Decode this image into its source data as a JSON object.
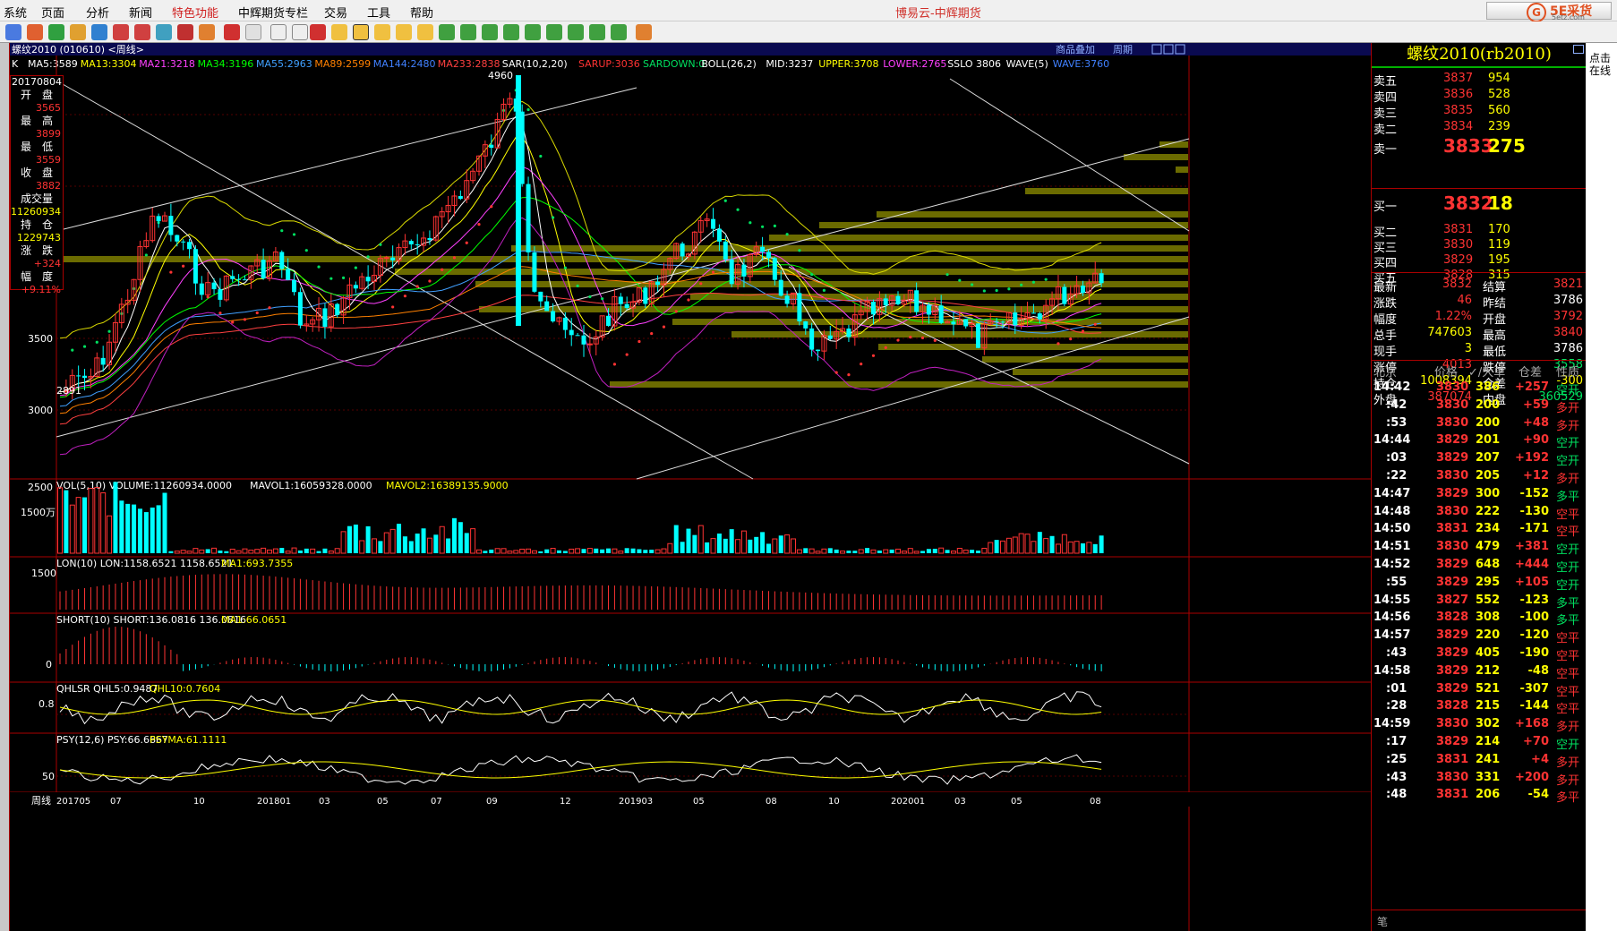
{
  "menu": {
    "items": [
      "系统",
      "页面",
      "分析",
      "新闻",
      "特色功能",
      "中辉期货专栏",
      "交易",
      "工具",
      "帮助"
    ],
    "window_title": "博易云-中辉期货",
    "brand": "5E采货",
    "brand_url": "5etz.com"
  },
  "chart": {
    "symbol_header": "螺纹2010 (010610) <周线>",
    "k_label": "K",
    "ma_line": [
      {
        "label": "MA5:3589",
        "color": "#ffffff"
      },
      {
        "label": "MA13:3304",
        "color": "#ffff00"
      },
      {
        "label": "MA21:3218",
        "color": "#ff40ff"
      },
      {
        "label": "MA34:3196",
        "color": "#00ff00"
      },
      {
        "label": "MA55:2963",
        "color": "#40a0ff"
      },
      {
        "label": "MA89:2599",
        "color": "#ff8000"
      },
      {
        "label": "MA144:2480",
        "color": "#4080ff"
      },
      {
        "label": "MA233:2838",
        "color": "#ff4040"
      },
      {
        "label": "SAR(10,2,20)",
        "color": "#ffffff"
      },
      {
        "label": "SARUP:3036",
        "color": "#ff3333"
      },
      {
        "label": "SARDOWN:0",
        "color": "#00e060"
      },
      {
        "label": "BOLL(26,2)",
        "color": "#ffffff"
      },
      {
        "label": "MID:3237",
        "color": "#ffffff"
      },
      {
        "label": "UPPER:3708",
        "color": "#ffff00"
      },
      {
        "label": "LOWER:2765",
        "color": "#ff40ff"
      },
      {
        "label": "SSLO 3806",
        "color": "#ffffff"
      },
      {
        "label": "WAVE(5)",
        "color": "#ffffff"
      },
      {
        "label": "WAVE:3760",
        "color": "#4080ff"
      }
    ],
    "header_links": [
      "商品叠加",
      "周期"
    ],
    "price_ticks": [
      "3500",
      "3000",
      "2500"
    ],
    "high_mark": "4960",
    "low_mark": "2891",
    "vol_header": "VOL(5,10) VOLUME:11260934.0000",
    "vol_ma1": "MAVOL1:16059328.0000",
    "vol_ma2": "MAVOL2:16389135.9000",
    "vol_tick": "1500万",
    "lon_header": "LON(10) LON:1158.6521 1158.6521",
    "lon_ma": "MA1:693.7355",
    "lon_tick": "1500",
    "short_header": "SHORT(10) SHORT:136.0816 136.0816",
    "short_ma": "MA1:66.0651",
    "short_tick": "0",
    "qhlsr_header": "QHLSR QHL5:0.9487",
    "qhlsr_ma": "QHL10:0.7604",
    "qhlsr_tick": "0.8",
    "psy_header": "PSY(12,6) PSY:66.6667",
    "psy_ma": "PSYMA:61.1111",
    "psy_tick": "50",
    "period_label": "周线",
    "x_ticks": [
      "201705",
      "07",
      "10",
      "201801",
      "03",
      "05",
      "07",
      "09",
      "12",
      "201903",
      "05",
      "08",
      "10",
      "202001",
      "03",
      "05",
      "08"
    ]
  },
  "infobox": {
    "date": "20170804",
    "rows": [
      {
        "label": "开　盘",
        "value": "3565",
        "color": "red"
      },
      {
        "label": "最　高",
        "value": "3899",
        "color": "red"
      },
      {
        "label": "最　低",
        "value": "3559",
        "color": "red"
      },
      {
        "label": "收　盘",
        "value": "3882",
        "color": "red"
      },
      {
        "label": "成交量",
        "value": "11260934",
        "color": "yel"
      },
      {
        "label": "持　仓",
        "value": "1229743",
        "color": "yel"
      },
      {
        "label": "涨　跌",
        "value": "+324",
        "color": "red"
      },
      {
        "label": "幅　度",
        "value": "+9.11%",
        "color": "red"
      }
    ]
  },
  "quote": {
    "title": "螺纹2010(rb2010)",
    "asks": [
      {
        "label": "卖五",
        "price": "3837",
        "vol": "954"
      },
      {
        "label": "卖四",
        "price": "3836",
        "vol": "528"
      },
      {
        "label": "卖三",
        "price": "3835",
        "vol": "560"
      },
      {
        "label": "卖二",
        "price": "3834",
        "vol": "239"
      },
      {
        "label": "卖一",
        "price": "3833",
        "vol": "275"
      }
    ],
    "bids": [
      {
        "label": "买一",
        "price": "3832",
        "vol": "18"
      },
      {
        "label": "买二",
        "price": "3831",
        "vol": "170"
      },
      {
        "label": "买三",
        "price": "3830",
        "vol": "119"
      },
      {
        "label": "买四",
        "price": "3829",
        "vol": "195"
      },
      {
        "label": "买五",
        "price": "3828",
        "vol": "315"
      }
    ],
    "stats": [
      {
        "l1": "最新",
        "v1": "3832",
        "c1": "red",
        "l2": "结算",
        "v2": "3821",
        "c2": "red"
      },
      {
        "l1": "涨跌",
        "v1": "46",
        "c1": "red",
        "l2": "昨结",
        "v2": "3786",
        "c2": "wht"
      },
      {
        "l1": "幅度",
        "v1": "1.22%",
        "c1": "red",
        "l2": "开盘",
        "v2": "3792",
        "c2": "red"
      },
      {
        "l1": "总手",
        "v1": "747603",
        "c1": "yel",
        "l2": "最高",
        "v2": "3840",
        "c2": "red"
      },
      {
        "l1": "现手",
        "v1": "3",
        "c1": "yel",
        "l2": "最低",
        "v2": "3786",
        "c2": "wht"
      },
      {
        "l1": "涨停",
        "v1": "4013",
        "c1": "red",
        "l2": "跌停",
        "v2": "3558",
        "c2": "grn"
      },
      {
        "l1": "持仓",
        "v1": "1008394",
        "c1": "yel",
        "l2": "仓差",
        "v2": "-300",
        "c2": "yel"
      },
      {
        "l1": "外盘",
        "v1": "387074",
        "c1": "red",
        "l2": "内盘",
        "v2": "360529",
        "c2": "grn"
      }
    ],
    "tick_header": [
      "北京",
      "价格",
      "✓/大单",
      "仓差",
      "性质"
    ],
    "ticks": [
      {
        "t": "14:42",
        "p": "3830",
        "v": "386",
        "d": "+257",
        "n": "空开",
        "nc": "grn"
      },
      {
        "t": ":42",
        "p": "3830",
        "v": "200",
        "d": "+59",
        "n": "多开",
        "nc": "red"
      },
      {
        "t": ":53",
        "p": "3830",
        "v": "200",
        "d": "+48",
        "n": "多开",
        "nc": "red"
      },
      {
        "t": "14:44",
        "p": "3829",
        "v": "201",
        "d": "+90",
        "n": "空开",
        "nc": "grn"
      },
      {
        "t": ":03",
        "p": "3829",
        "v": "207",
        "d": "+192",
        "n": "空开",
        "nc": "grn"
      },
      {
        "t": ":22",
        "p": "3830",
        "v": "205",
        "d": "+12",
        "n": "多开",
        "nc": "red"
      },
      {
        "t": "14:47",
        "p": "3829",
        "v": "300",
        "d": "-152",
        "n": "多平",
        "nc": "grn"
      },
      {
        "t": "14:48",
        "p": "3830",
        "v": "222",
        "d": "-130",
        "n": "空平",
        "nc": "red"
      },
      {
        "t": "14:50",
        "p": "3831",
        "v": "234",
        "d": "-171",
        "n": "空平",
        "nc": "red"
      },
      {
        "t": "14:51",
        "p": "3830",
        "v": "479",
        "d": "+381",
        "n": "空开",
        "nc": "grn"
      },
      {
        "t": "14:52",
        "p": "3829",
        "v": "648",
        "d": "+444",
        "n": "空开",
        "nc": "grn"
      },
      {
        "t": ":55",
        "p": "3829",
        "v": "295",
        "d": "+105",
        "n": "空开",
        "nc": "grn"
      },
      {
        "t": "14:55",
        "p": "3827",
        "v": "552",
        "d": "-123",
        "n": "多平",
        "nc": "grn"
      },
      {
        "t": "14:56",
        "p": "3828",
        "v": "308",
        "d": "-100",
        "n": "多平",
        "nc": "grn"
      },
      {
        "t": "14:57",
        "p": "3829",
        "v": "220",
        "d": "-120",
        "n": "空平",
        "nc": "red"
      },
      {
        "t": ":43",
        "p": "3829",
        "v": "405",
        "d": "-190",
        "n": "空平",
        "nc": "red"
      },
      {
        "t": "14:58",
        "p": "3829",
        "v": "212",
        "d": "-48",
        "n": "空平",
        "nc": "red"
      },
      {
        "t": ":01",
        "p": "3829",
        "v": "521",
        "d": "-307",
        "n": "空平",
        "nc": "red"
      },
      {
        "t": ":28",
        "p": "3828",
        "v": "215",
        "d": "-144",
        "n": "空平",
        "nc": "red"
      },
      {
        "t": "14:59",
        "p": "3830",
        "v": "302",
        "d": "+168",
        "n": "多开",
        "nc": "red"
      },
      {
        "t": ":17",
        "p": "3829",
        "v": "214",
        "d": "+70",
        "n": "空开",
        "nc": "grn"
      },
      {
        "t": ":25",
        "p": "3831",
        "v": "241",
        "d": "+4",
        "n": "多开",
        "nc": "red"
      },
      {
        "t": ":43",
        "p": "3830",
        "v": "331",
        "d": "+200",
        "n": "多开",
        "nc": "red"
      },
      {
        "t": ":48",
        "p": "3831",
        "v": "206",
        "d": "-54",
        "n": "多平",
        "nc": "red"
      }
    ],
    "footer": "笔"
  },
  "side_text": "点击在线"
}
